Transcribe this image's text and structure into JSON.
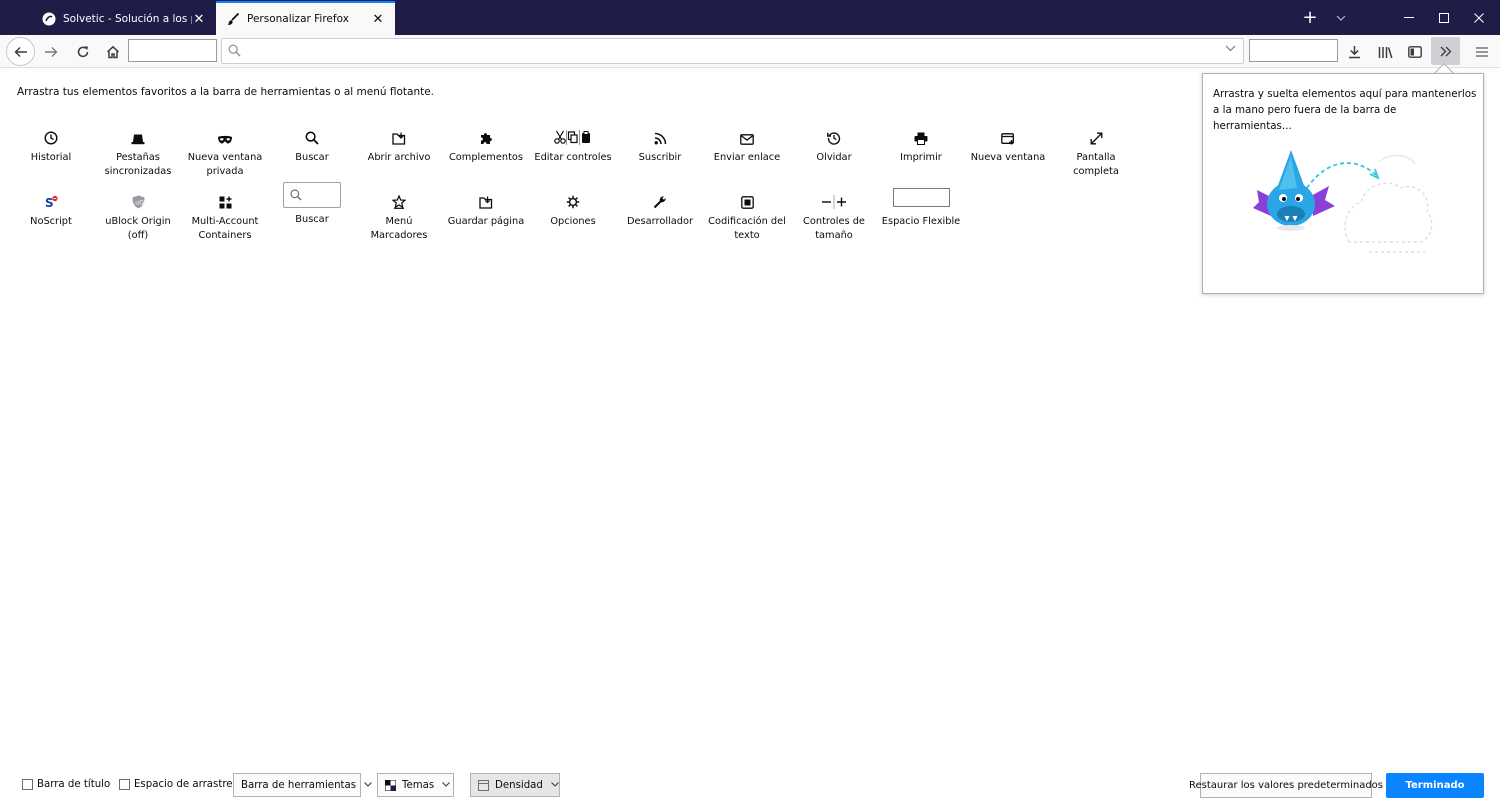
{
  "tabs": [
    {
      "title": "Solvetic - Solución a los proble",
      "active": false
    },
    {
      "title": "Personalizar Firefox",
      "active": true
    }
  ],
  "instruction": "Arrastra tus elementos favoritos a la barra de herramientas o al menú flotante.",
  "palette_row1": [
    {
      "label": "Historial",
      "icon": "clock-icon"
    },
    {
      "label": "Pestañas sincronizadas",
      "icon": "synced-tabs-icon"
    },
    {
      "label": "Nueva ventana privada",
      "icon": "private-mask-icon"
    },
    {
      "label": "Buscar",
      "icon": "search-icon"
    },
    {
      "label": "Abrir archivo",
      "icon": "open-file-icon"
    },
    {
      "label": "Complementos",
      "icon": "puzzle-icon"
    },
    {
      "label": "Editar controles",
      "icon": "cut-copy-paste-icon"
    },
    {
      "label": "Suscribir",
      "icon": "rss-icon"
    },
    {
      "label": "Enviar enlace",
      "icon": "mail-icon"
    },
    {
      "label": "Olvidar",
      "icon": "forget-icon"
    },
    {
      "label": "Imprimir",
      "icon": "printer-icon"
    },
    {
      "label": "Nueva ventana",
      "icon": "new-window-icon"
    },
    {
      "label": "Pantalla completa",
      "icon": "fullscreen-icon"
    }
  ],
  "palette_row2": [
    {
      "label": "NoScript",
      "icon": "noscript-icon"
    },
    {
      "label": "uBlock Origin (off)",
      "icon": "ublock-icon"
    },
    {
      "label": "Multi-Account Containers",
      "icon": "containers-icon"
    },
    {
      "label": "Buscar",
      "icon": "search-field-icon"
    },
    {
      "label": "Menú Marcadores",
      "icon": "bookmark-star-icon"
    },
    {
      "label": "Guardar página",
      "icon": "save-page-icon"
    },
    {
      "label": "Opciones",
      "icon": "gear-icon"
    },
    {
      "label": "Desarrollador",
      "icon": "wrench-icon"
    },
    {
      "label": "Codificación del texto",
      "icon": "text-encoding-icon"
    },
    {
      "label": "Controles de tamaño",
      "icon": "zoom-controls-icon"
    },
    {
      "label": "Espacio Flexible",
      "icon": "flexible-space-icon"
    }
  ],
  "overflow_panel": {
    "text": "Arrastra y suelta elementos aquí para mantenerlos a la mano pero fuera de la barra de herramientas..."
  },
  "bottom": {
    "titlebar_checkbox": "Barra de título",
    "dragspace_checkbox": "Espacio de arrastre",
    "toolbars_dropdown": "Barra de herramientas",
    "themes_dropdown": "Temas",
    "density_dropdown": "Densidad",
    "restore_button": "Restaurar los valores predeterminados",
    "done_button": "Terminado"
  },
  "colors": {
    "tabstrip": "#1f1d48",
    "accent": "#0a84ff",
    "toolbar": "#f9f9fa"
  }
}
